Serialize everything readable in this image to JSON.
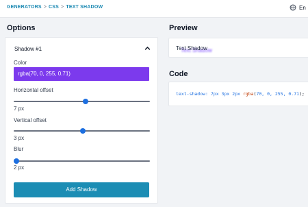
{
  "breadcrumb": {
    "items": [
      "GENERATORS",
      "CSS",
      "TEXT SHADOW"
    ],
    "separator": ">"
  },
  "language": {
    "label": "En",
    "icon": "globe-icon"
  },
  "options": {
    "heading": "Options",
    "section_title": "Shadow #1",
    "color_label": "Color",
    "color_value": "rgba(70, 0, 255, 0.71)",
    "horizontal_label": "Horizontal offset",
    "horizontal_value": "7 px",
    "horizontal_fraction": 0.53,
    "vertical_label": "Vertical offset",
    "vertical_value": "3 px",
    "vertical_fraction": 0.51,
    "blur_label": "Blur",
    "blur_value": "2 px",
    "blur_fraction": 0.02,
    "add_button": "Add Shadow"
  },
  "preview": {
    "heading": "Preview",
    "text": "Text Shadow"
  },
  "code": {
    "heading": "Code",
    "property": "text-shadow:",
    "values": "7px 3px 2px",
    "fn": "rgba",
    "open": "(",
    "args": "70, 0, 255, 0.71",
    "close": ");"
  },
  "colors": {
    "accent": "#1c8db4",
    "color_swatch": "#7c3aed",
    "slider_thumb": "#1d6fe0",
    "breadcrumb": "#1d8ab3"
  }
}
